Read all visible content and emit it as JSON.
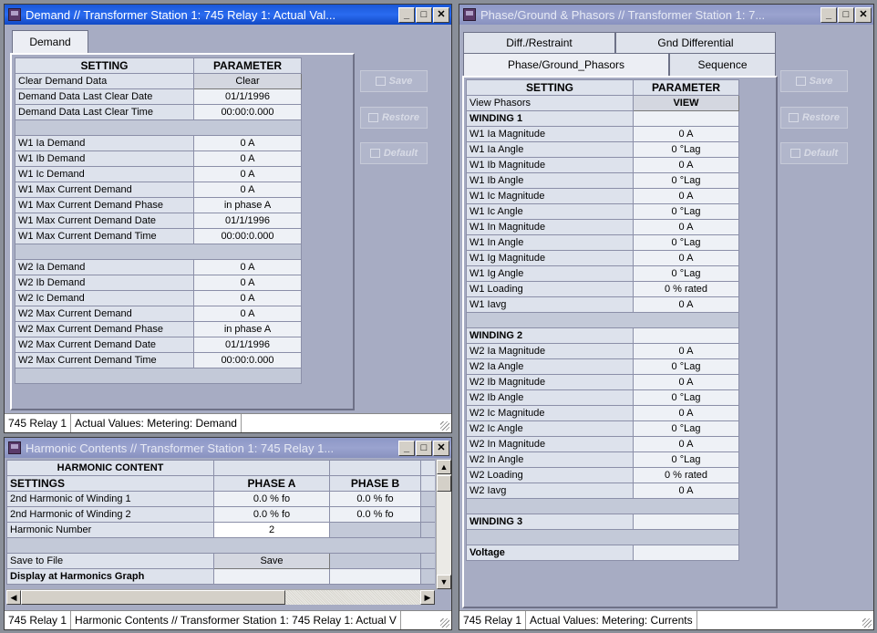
{
  "demand_window": {
    "title": "Demand // Transformer Station 1: 745 Relay 1: Actual Val...",
    "tab": "Demand",
    "headers": [
      "SETTING",
      "PARAMETER"
    ],
    "rows": [
      {
        "setting": "Clear Demand Data",
        "value": "Clear",
        "type": "button"
      },
      {
        "setting": "Demand Data Last Clear Date",
        "value": "01/1/1996"
      },
      {
        "setting": "Demand Data Last Clear Time",
        "value": "00:00:0.000"
      },
      {
        "type": "sep"
      },
      {
        "setting": "W1 Ia Demand",
        "value": "0 A"
      },
      {
        "setting": "W1 Ib Demand",
        "value": "0 A"
      },
      {
        "setting": "W1 Ic Demand",
        "value": "0 A"
      },
      {
        "setting": "W1 Max Current Demand",
        "value": "0 A"
      },
      {
        "setting": "W1 Max Current Demand Phase",
        "value": "in phase A"
      },
      {
        "setting": "W1 Max Current Demand Date",
        "value": "01/1/1996"
      },
      {
        "setting": "W1 Max Current Demand Time",
        "value": "00:00:0.000"
      },
      {
        "type": "sep"
      },
      {
        "setting": "W2 Ia Demand",
        "value": "0 A"
      },
      {
        "setting": "W2 Ib Demand",
        "value": "0 A"
      },
      {
        "setting": "W2 Ic Demand",
        "value": "0 A"
      },
      {
        "setting": "W2 Max Current Demand",
        "value": "0 A"
      },
      {
        "setting": "W2 Max Current Demand Phase",
        "value": "in phase A"
      },
      {
        "setting": "W2 Max Current Demand Date",
        "value": "01/1/1996"
      },
      {
        "setting": "W2 Max Current Demand Time",
        "value": "00:00:0.000"
      },
      {
        "type": "sep"
      }
    ],
    "buttons": {
      "save": "Save",
      "restore": "Restore",
      "default": "Default"
    },
    "status": {
      "device": "745 Relay 1",
      "path": "Actual Values: Metering: Demand"
    }
  },
  "harmonic_window": {
    "title": "Harmonic Contents // Transformer Station 1: 745 Relay 1...",
    "section_header": "HARMONIC CONTENT",
    "headers": [
      "SETTINGS",
      "PHASE A",
      "PHASE B"
    ],
    "rows": [
      {
        "setting": "2nd Harmonic of Winding 1",
        "a": "0.0 % fo",
        "b": "0.0 % fo"
      },
      {
        "setting": "2nd Harmonic of Winding 2",
        "a": "0.0 % fo",
        "b": "0.0 % fo"
      },
      {
        "setting": "Harmonic Number",
        "a": "2",
        "b": "",
        "type": "input"
      },
      {
        "type": "sep"
      },
      {
        "setting": "Save to File",
        "a": "Save",
        "b": "",
        "type": "button"
      },
      {
        "setting": "Display at Harmonics Graph",
        "a": "",
        "b": "",
        "type": "bold"
      }
    ],
    "status": {
      "device": "745 Relay 1",
      "path": "Harmonic Contents // Transformer Station 1: 745 Relay 1: Actual V"
    }
  },
  "phasor_window": {
    "title": "Phase/Ground & Phasors // Transformer Station 1: 7...",
    "tabs_row1": [
      "Diff./Restraint",
      "Gnd Differential"
    ],
    "tabs_row2": [
      "Phase/Ground_Phasors",
      "Sequence"
    ],
    "headers": [
      "SETTING",
      "PARAMETER"
    ],
    "rows": [
      {
        "setting": "View Phasors",
        "value": "VIEW",
        "type": "button"
      },
      {
        "setting": "WINDING 1",
        "value": "",
        "type": "bold"
      },
      {
        "setting": "W1 Ia Magnitude",
        "value": "0 A"
      },
      {
        "setting": "W1 Ia Angle",
        "value": "0 °Lag"
      },
      {
        "setting": "W1 Ib Magnitude",
        "value": "0 A"
      },
      {
        "setting": "W1 Ib Angle",
        "value": "0 °Lag"
      },
      {
        "setting": "W1 Ic Magnitude",
        "value": "0 A"
      },
      {
        "setting": "W1 Ic Angle",
        "value": "0 °Lag"
      },
      {
        "setting": "W1 In Magnitude",
        "value": "0 A"
      },
      {
        "setting": "W1 In Angle",
        "value": "0 °Lag"
      },
      {
        "setting": "W1 Ig Magnitude",
        "value": "0 A"
      },
      {
        "setting": "W1 Ig Angle",
        "value": "0 °Lag"
      },
      {
        "setting": "W1 Loading",
        "value": "0 % rated"
      },
      {
        "setting": "W1 Iavg",
        "value": "0 A"
      },
      {
        "type": "sep"
      },
      {
        "setting": "WINDING 2",
        "value": "",
        "type": "bold"
      },
      {
        "setting": "W2 Ia Magnitude",
        "value": "0 A"
      },
      {
        "setting": "W2 Ia Angle",
        "value": "0 °Lag"
      },
      {
        "setting": "W2 Ib Magnitude",
        "value": "0 A"
      },
      {
        "setting": "W2 Ib Angle",
        "value": "0 °Lag"
      },
      {
        "setting": "W2 Ic Magnitude",
        "value": "0 A"
      },
      {
        "setting": "W2 Ic Angle",
        "value": "0 °Lag"
      },
      {
        "setting": "W2 In Magnitude",
        "value": "0 A"
      },
      {
        "setting": "W2 In Angle",
        "value": "0 °Lag"
      },
      {
        "setting": "W2 Loading",
        "value": "0 % rated"
      },
      {
        "setting": "W2 Iavg",
        "value": "0 A"
      },
      {
        "type": "sep"
      },
      {
        "setting": "WINDING 3",
        "value": "",
        "type": "bold"
      },
      {
        "type": "sep"
      },
      {
        "setting": "Voltage",
        "value": "",
        "type": "bold"
      }
    ],
    "buttons": {
      "save": "Save",
      "restore": "Restore",
      "default": "Default"
    },
    "status": {
      "device": "745 Relay 1",
      "path": "Actual Values: Metering: Currents"
    }
  },
  "window_controls": {
    "minimize": "_",
    "maximize": "□",
    "close": "✕"
  }
}
